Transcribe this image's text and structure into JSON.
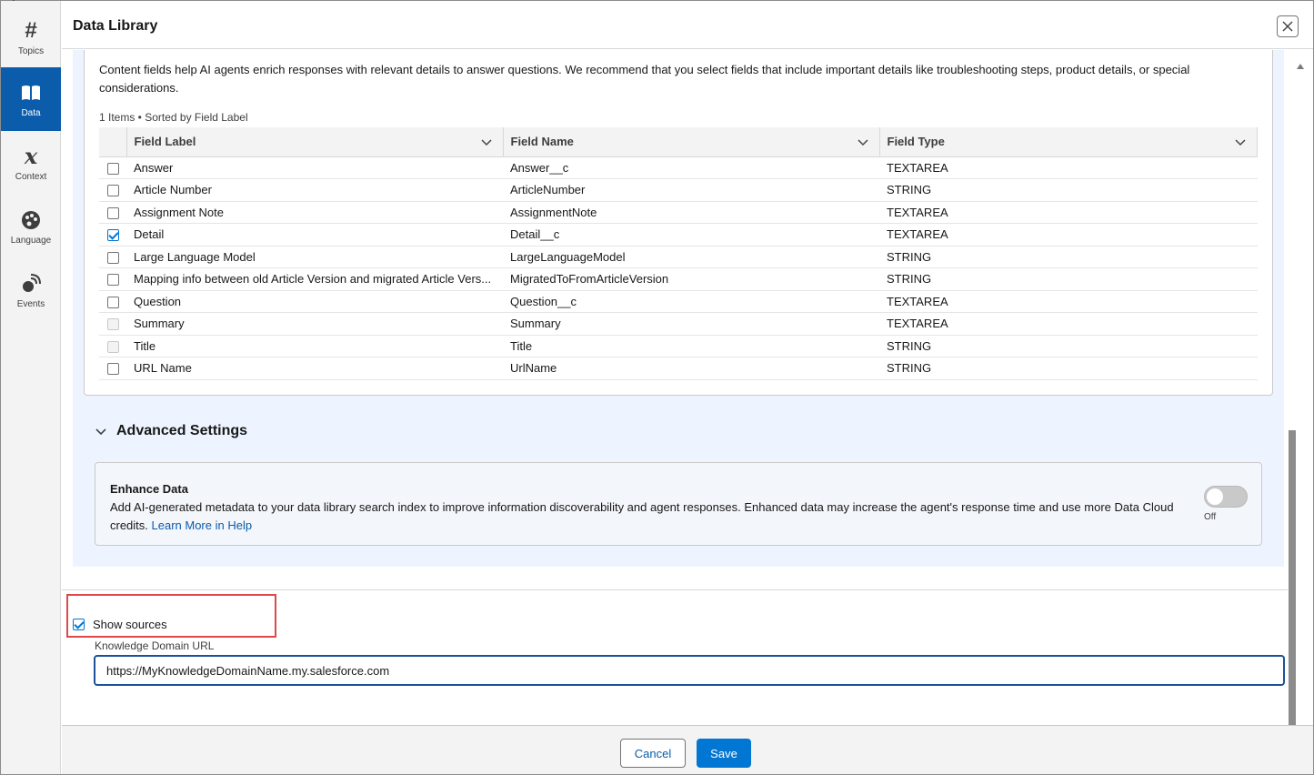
{
  "rail": {
    "items": [
      {
        "label": "Topics",
        "icon": "hash-icon",
        "glyph": "#",
        "active": false
      },
      {
        "label": "Data",
        "icon": "book-icon",
        "glyph": "",
        "active": true
      },
      {
        "label": "Context",
        "icon": "variable-icon",
        "glyph": "𝔁",
        "active": false
      },
      {
        "label": "Language",
        "icon": "palette-icon",
        "glyph": "",
        "active": false
      },
      {
        "label": "Events",
        "icon": "broadcast-icon",
        "glyph": "",
        "active": false
      }
    ]
  },
  "header": {
    "title": "Data Library"
  },
  "content_fields": {
    "description": "Content fields help AI agents enrich responses with relevant details to answer questions. We recommend that you select fields that include important details like troubleshooting steps, product details, or special considerations.",
    "meta": "1 Items • Sorted by Field Label",
    "columns": [
      "Field Label",
      "Field Name",
      "Field Type"
    ],
    "rows": [
      {
        "label": "Answer",
        "name": "Answer__c",
        "type": "TEXTAREA",
        "state": "unchecked"
      },
      {
        "label": "Article Number",
        "name": "ArticleNumber",
        "type": "STRING",
        "state": "unchecked"
      },
      {
        "label": "Assignment Note",
        "name": "AssignmentNote",
        "type": "TEXTAREA",
        "state": "unchecked"
      },
      {
        "label": "Detail",
        "name": "Detail__c",
        "type": "TEXTAREA",
        "state": "checked"
      },
      {
        "label": "Large Language Model",
        "name": "LargeLanguageModel",
        "type": "STRING",
        "state": "unchecked"
      },
      {
        "label": "Mapping info between old Article Version and migrated Article Vers...",
        "name": "MigratedToFromArticleVersion",
        "type": "STRING",
        "state": "unchecked"
      },
      {
        "label": "Question",
        "name": "Question__c",
        "type": "TEXTAREA",
        "state": "unchecked"
      },
      {
        "label": "Summary",
        "name": "Summary",
        "type": "TEXTAREA",
        "state": "disabled"
      },
      {
        "label": "Title",
        "name": "Title",
        "type": "STRING",
        "state": "disabled"
      },
      {
        "label": "URL Name",
        "name": "UrlName",
        "type": "STRING",
        "state": "unchecked"
      }
    ]
  },
  "advanced": {
    "title": "Advanced Settings",
    "enhance": {
      "title": "Enhance Data",
      "text": "Add AI-generated metadata to your data library search index to improve information discoverability and agent responses. Enhanced data may increase the agent's response time and use more Data Cloud credits. ",
      "link": "Learn More in Help",
      "toggle_label": "Off"
    }
  },
  "sources": {
    "show_sources_label": "Show sources",
    "url_label": "Knowledge Domain URL",
    "url_value": "https://MyKnowledgeDomainName.my.salesforce.com"
  },
  "footer": {
    "cancel": "Cancel",
    "save": "Save"
  },
  "colors": {
    "brand": "#0176d3",
    "active_rail": "#0b5cab",
    "highlight": "#e0474c"
  }
}
